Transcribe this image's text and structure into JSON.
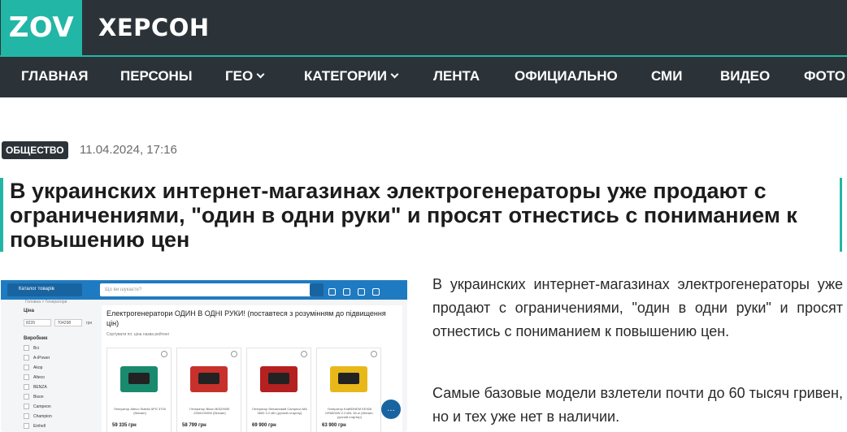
{
  "header": {
    "logo": "ZOV",
    "city": "ХЕРСОН"
  },
  "nav": {
    "items": [
      {
        "label": "ГЛАВНАЯ",
        "dropdown": false
      },
      {
        "label": "ПЕРСОНЫ",
        "dropdown": false
      },
      {
        "label": "ГЕО",
        "dropdown": true
      },
      {
        "label": "КАТЕГОРИИ",
        "dropdown": true
      },
      {
        "label": "ЛЕНТА",
        "dropdown": false
      },
      {
        "label": "ОФИЦИАЛЬНО",
        "dropdown": false
      },
      {
        "label": "СМИ",
        "dropdown": false
      },
      {
        "label": "ВИДЕО",
        "dropdown": false
      },
      {
        "label": "ФОТО",
        "dropdown": false
      }
    ]
  },
  "article": {
    "category": "ОБЩЕСТВО",
    "date": "11.04.2024, 17:16",
    "title": "В украинских интернет-магазинах электрогенераторы уже продают с ограничениями, \"один в одни руки\" и просят отнестись с пониманием к повышению цен",
    "paragraphs": [
      "В украинских интернет-магазинах электрогенераторы уже продают с ограничениями, \"один в одни руки\" и просят отнестись с пониманием к повышению цен.",
      "Самые базовые модели взлетели почти до 60 тысяч гривен, но и тех уже нет в наличии."
    ],
    "image": {
      "catalog_button": "Каталог товарів",
      "search_placeholder": "Що ви шукаєте?",
      "breadcrumb": "Головна > Генератори",
      "filter_price_label": "Ціна",
      "price_min": "8235",
      "price_max": "704298",
      "currency": "грн",
      "filter_brand_label": "Виробник",
      "brands": [
        "Всі",
        "A-iPower",
        "Akop",
        "Alteco",
        "BENZA",
        "Bison",
        "Campeon",
        "Champion",
        "Einhell"
      ],
      "heading": "Електрогенератори ОДИН В ОДНІ РУКИ! (поставтеся з розумінням до підвищення цін)",
      "sort_label": "Сортувати по:  ціна   назва   рейтинг",
      "products": [
        {
          "caption": "Генератор Alteco Stabilo 5PG 3700 (бензин)",
          "price": "59 335 грн",
          "color": "#1a8a6e"
        },
        {
          "caption": "Генератор Bison BIS2900E 2900/2300W (бензин)",
          "price": "58 799 грн",
          "color": "#c8312b"
        },
        {
          "caption": "Генератор бензиновий Campeon MA 3600 3.2 кВт (ручний стартер)",
          "price": "69 900 грн",
          "color": "#b52020"
        },
        {
          "caption": "Генератор KraftEINEM KE926 KR6500W 2.2 кВт, 36 кг (бензин, ручний стартер)",
          "price": "63 900 грн",
          "color": "#e8b81b"
        }
      ],
      "chat_icon": "chat-icon"
    }
  },
  "colors": {
    "accent": "#22b6a6",
    "dark": "#2c3338",
    "shop_blue": "#1f7bc1"
  }
}
